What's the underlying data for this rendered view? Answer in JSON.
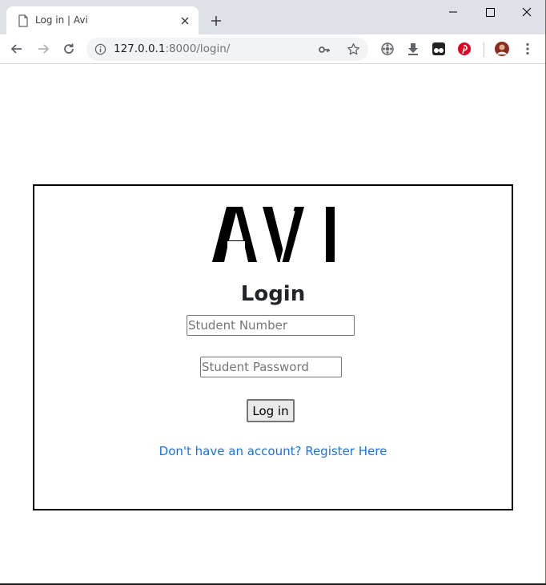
{
  "browser": {
    "tab_title": "Log in | Avi",
    "url_host": "127.0.0.1",
    "url_rest": ":8000/login/",
    "icons": [
      "page-icon",
      "close-icon",
      "plus-icon",
      "minimize-icon",
      "maximize-icon",
      "close-window-icon",
      "back-arrow-icon",
      "forward-arrow-icon",
      "reload-icon",
      "info-icon",
      "key-icon",
      "star-icon",
      "extension-icon",
      "download-icon",
      "tampermonkey-icon",
      "pinterest-icon",
      "profile-avatar",
      "menu-icon"
    ]
  },
  "page": {
    "logo_text": "AVI",
    "heading": "Login",
    "student_number_placeholder": "Student Number",
    "student_password_placeholder": "Student Password",
    "login_button": "Log in",
    "register_link": "Don't have an account? Register Here"
  },
  "colors": {
    "link": "#1a73e8",
    "chrome_bg": "#dee1e6",
    "pinterest": "#e60023"
  }
}
